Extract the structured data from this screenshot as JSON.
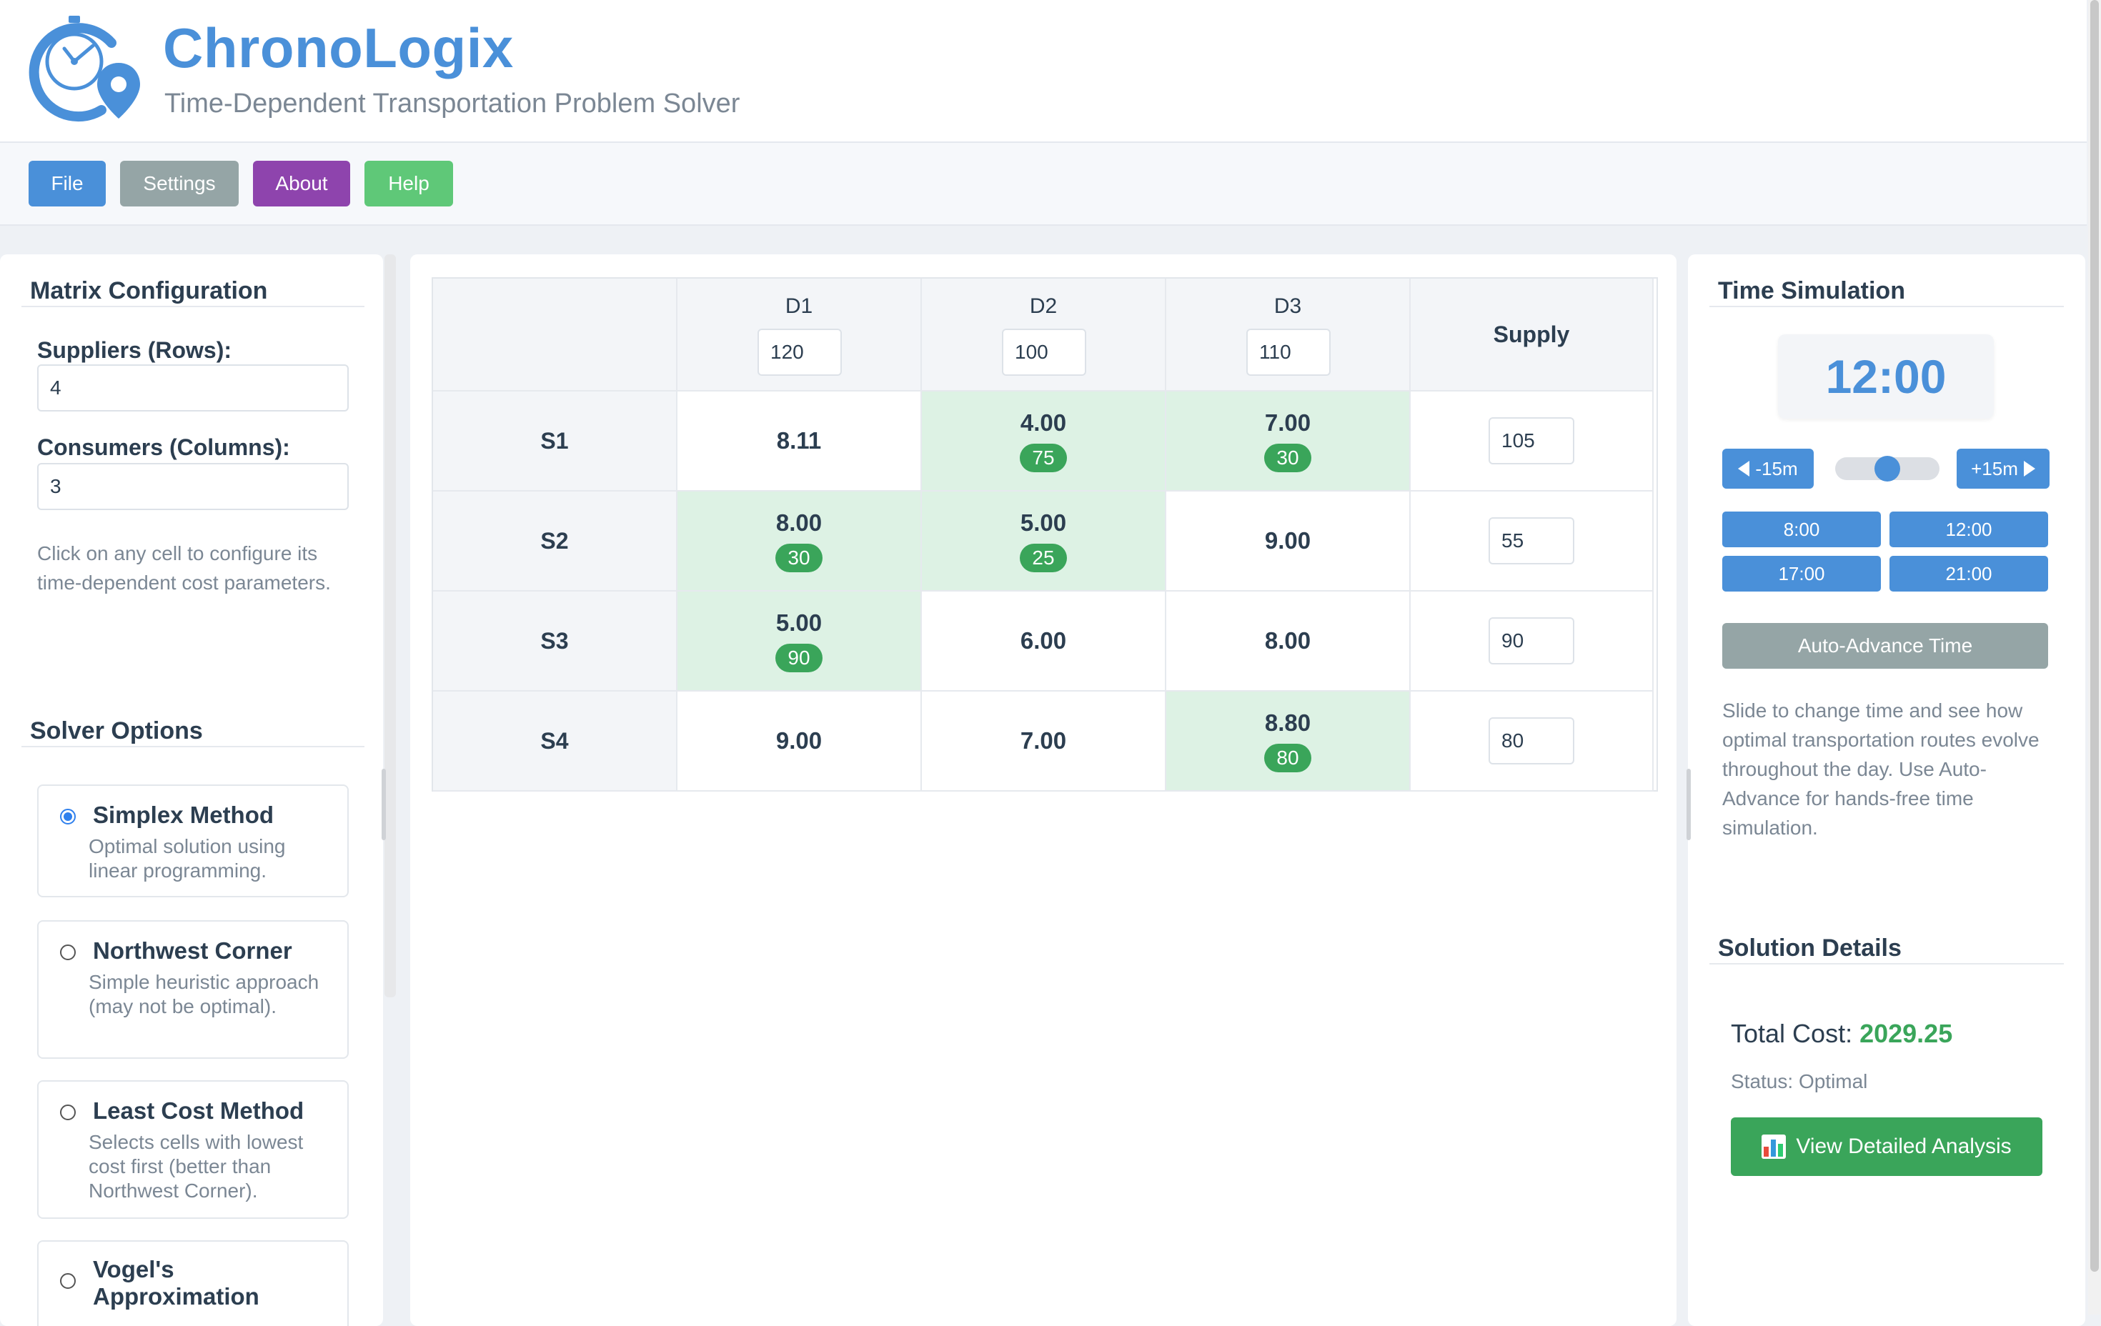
{
  "app": {
    "title": "ChronoLogix",
    "subtitle": "Time-Dependent Transportation Problem Solver"
  },
  "toolbar": {
    "buttons": [
      {
        "label": "File",
        "color": "#4a90d9"
      },
      {
        "label": "Settings",
        "color": "#95a5a6"
      },
      {
        "label": "About",
        "color": "#8e44ad"
      },
      {
        "label": "Help",
        "color": "#5fc878"
      }
    ]
  },
  "matrix_config": {
    "title": "Matrix Configuration",
    "suppliers_label": "Suppliers (Rows):",
    "suppliers_value": "4",
    "consumers_label": "Consumers (Columns):",
    "consumers_value": "3",
    "hint": "Click on any cell to configure its time-dependent cost parameters."
  },
  "solver_options": {
    "title": "Solver Options",
    "options": [
      {
        "title": "Simplex Method",
        "desc": "Optimal solution using linear programming.",
        "checked": true
      },
      {
        "title": "Northwest Corner",
        "desc": "Simple heuristic approach (may not be optimal).",
        "checked": false
      },
      {
        "title": "Least Cost Method",
        "desc": "Selects cells with lowest cost first (better than Northwest Corner).",
        "checked": false
      },
      {
        "title": "Vogel's Approximation",
        "desc": "",
        "checked": false
      }
    ]
  },
  "matrix": {
    "supply_header": "Supply",
    "demands": [
      {
        "label": "D1",
        "value": "120"
      },
      {
        "label": "D2",
        "value": "100"
      },
      {
        "label": "D3",
        "value": "110"
      }
    ],
    "rows": [
      {
        "label": "S1",
        "supply": "105",
        "cells": [
          {
            "cost": "8.11",
            "alloc": ""
          },
          {
            "cost": "4.00",
            "alloc": "75"
          },
          {
            "cost": "7.00",
            "alloc": "30"
          }
        ]
      },
      {
        "label": "S2",
        "supply": "55",
        "cells": [
          {
            "cost": "8.00",
            "alloc": "30"
          },
          {
            "cost": "5.00",
            "alloc": "25"
          },
          {
            "cost": "9.00",
            "alloc": ""
          }
        ]
      },
      {
        "label": "S3",
        "supply": "90",
        "cells": [
          {
            "cost": "5.00",
            "alloc": "90"
          },
          {
            "cost": "6.00",
            "alloc": ""
          },
          {
            "cost": "8.00",
            "alloc": ""
          }
        ]
      },
      {
        "label": "S4",
        "supply": "80",
        "cells": [
          {
            "cost": "9.00",
            "alloc": ""
          },
          {
            "cost": "7.00",
            "alloc": ""
          },
          {
            "cost": "8.80",
            "alloc": "80"
          }
        ]
      }
    ]
  },
  "time_sim": {
    "title": "Time Simulation",
    "clock": "12:00",
    "back_label": "-15m",
    "forward_label": "+15m",
    "slider_level": 0.5,
    "presets": [
      "8:00",
      "12:00",
      "17:00",
      "21:00"
    ],
    "auto_label": "Auto-Advance Time",
    "hint": "Slide to change time and see how optimal transportation routes evolve throughout the day. Use Auto-Advance for hands-free time simulation."
  },
  "solution": {
    "title": "Solution Details",
    "total_label": "Total Cost:",
    "total_value": "2029.25",
    "status": "Status: Optimal",
    "analysis_label": "View Detailed Analysis"
  },
  "icons": {
    "logo": "clock-location-pin-icon",
    "analysis": "bar-chart-icon"
  }
}
